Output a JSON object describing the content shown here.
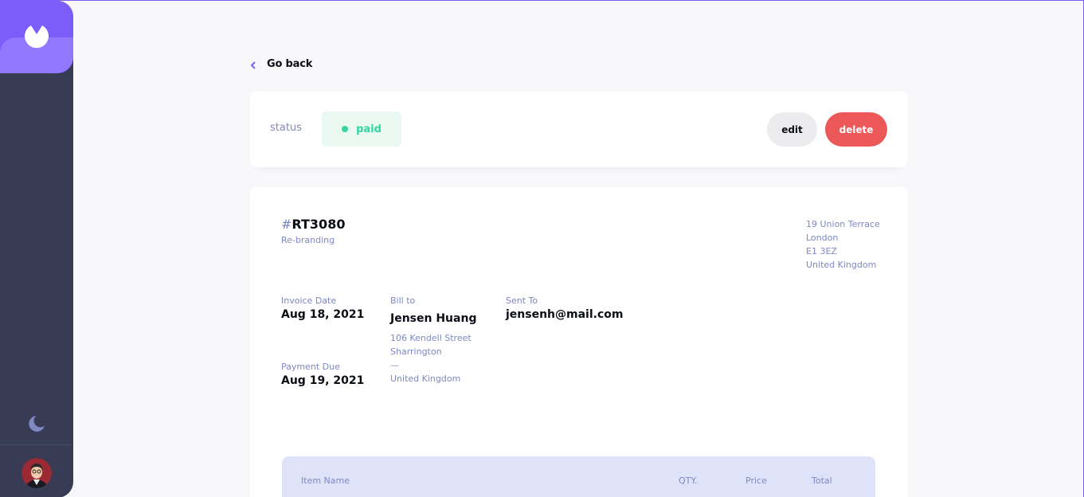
{
  "nav": {
    "go_back": "Go back"
  },
  "status_bar": {
    "label": "status",
    "status": "paid",
    "edit_label": "edit",
    "delete_label": "delete"
  },
  "invoice": {
    "id_prefix": "#",
    "id": "RT3080",
    "description": "Re-branding",
    "sender_address": {
      "street": "19 Union Terrace",
      "city": "London",
      "post_code": "E1 3EZ",
      "country": "United Kingdom"
    },
    "invoice_date_label": "Invoice Date",
    "invoice_date": "Aug 18, 2021",
    "payment_due_label": "Payment Due",
    "payment_due": "Aug 19, 2021",
    "bill_to_label": "Bill to",
    "client_name": "Jensen Huang",
    "client_address": {
      "street": "106 Kendell Street",
      "city": "Sharrington",
      "post_code": "—",
      "country": "United Kingdom"
    },
    "sent_to_label": "Sent To",
    "client_email": "jensenh@mail.com"
  },
  "items_table": {
    "headers": [
      "Item Name",
      "QTY.",
      "Price",
      "Total"
    ]
  },
  "colors": {
    "accent": "#7c5dfa",
    "sidebar": "#373b53",
    "paid": "#33d69f",
    "danger": "#ec5757"
  },
  "icons": {
    "logo": "logo-icon",
    "back": "chevron-left-icon",
    "theme": "moon-icon",
    "status": "status-dot-icon"
  }
}
